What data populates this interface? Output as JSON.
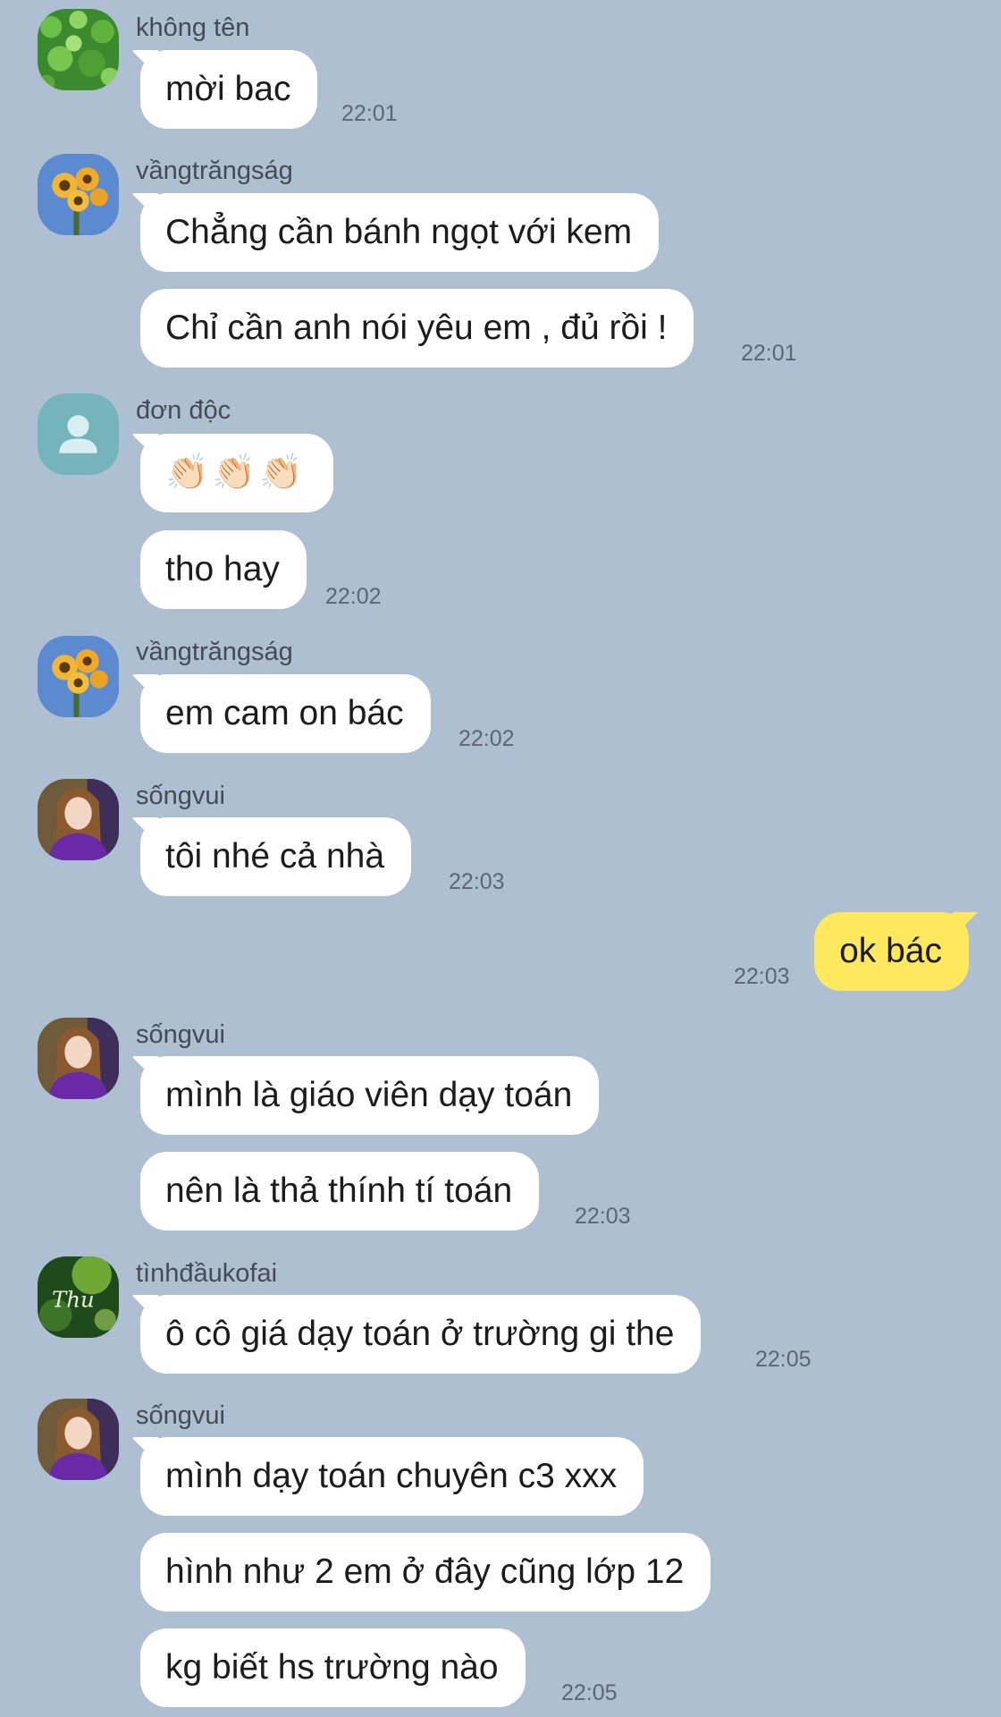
{
  "messages": [
    {
      "sender": "không tên",
      "bubbles": [
        "mời bac"
      ],
      "time": "22:01"
    },
    {
      "sender": "vầngtrăngság",
      "bubbles": [
        "Chẳng cần bánh ngọt với kem",
        "Chỉ cần anh nói yêu em , đủ rồi !"
      ],
      "time": "22:01"
    },
    {
      "sender": "đơn độc",
      "bubbles": [
        "👏🏻👏🏻👏🏻",
        "tho hay"
      ],
      "time": "22:02"
    },
    {
      "sender": "vầngtrăngság",
      "bubbles": [
        "em cam on bác"
      ],
      "time": "22:02"
    },
    {
      "sender": "sốngvui",
      "bubbles": [
        "tôi nhé cả nhà"
      ],
      "time": "22:03"
    },
    {
      "sender": "me",
      "bubbles": [
        "ok bác"
      ],
      "time": "22:03"
    },
    {
      "sender": "sốngvui",
      "bubbles": [
        "mình là giáo viên dạy toán",
        "nên là thả thính tí toán"
      ],
      "time": "22:03"
    },
    {
      "sender": "tìnhđầukofai",
      "bubbles": [
        "ô cô giá dạy toán ở trường gi the"
      ],
      "time": "22:05"
    },
    {
      "sender": "sốngvui",
      "bubbles": [
        "mình dạy toán chuyên c3 xxx",
        "hình như 2 em ở đây cũng lớp 12",
        "kg biết hs trường nào"
      ],
      "time": "22:05"
    }
  ],
  "avatars": {
    "khong_ten": "green-leaves-avatar",
    "vang_trang_sag": "sunflower-avatar",
    "don_doc": "default-user-avatar",
    "song_vui": "girl-portrait-avatar",
    "tinh_dau_kofai": "green-bokeh-avatar"
  },
  "avatar_text": {
    "tinh_dau_kofai": "Thu"
  },
  "colors": {
    "background": "#adbfd1",
    "bubble_incoming": "#ffffff",
    "bubble_outgoing": "#fde85e"
  }
}
